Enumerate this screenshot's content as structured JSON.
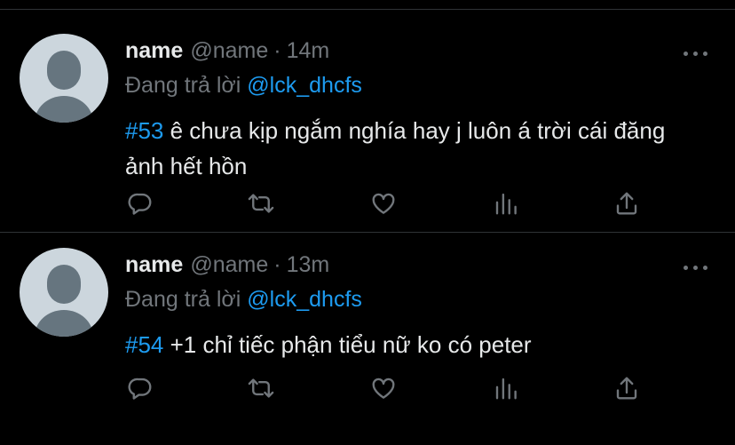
{
  "colors": {
    "background": "#000000",
    "accent": "#1d9bf0",
    "muted": "#71767b",
    "text": "#e7e9ea"
  },
  "tweets": [
    {
      "name": "name",
      "handle": "@name",
      "separator": "·",
      "time": "14m",
      "reply_prefix": "Đang trả lời",
      "reply_to": "@lck_dhcfs",
      "hashtag": "#53",
      "text": " ê chưa kịp ngắm nghía hay j luôn á trời cái đăng ảnh hết hồn",
      "actions": [
        "reply-icon",
        "retweet-icon",
        "like-icon",
        "analytics-icon",
        "share-icon"
      ]
    },
    {
      "name": "name",
      "handle": "@name",
      "separator": "·",
      "time": "13m",
      "reply_prefix": "Đang trả lời",
      "reply_to": "@lck_dhcfs",
      "hashtag": "#54",
      "text": " +1 chỉ tiếc phận tiểu nữ ko có peter",
      "actions": [
        "reply-icon",
        "retweet-icon",
        "like-icon",
        "analytics-icon",
        "share-icon"
      ]
    }
  ]
}
